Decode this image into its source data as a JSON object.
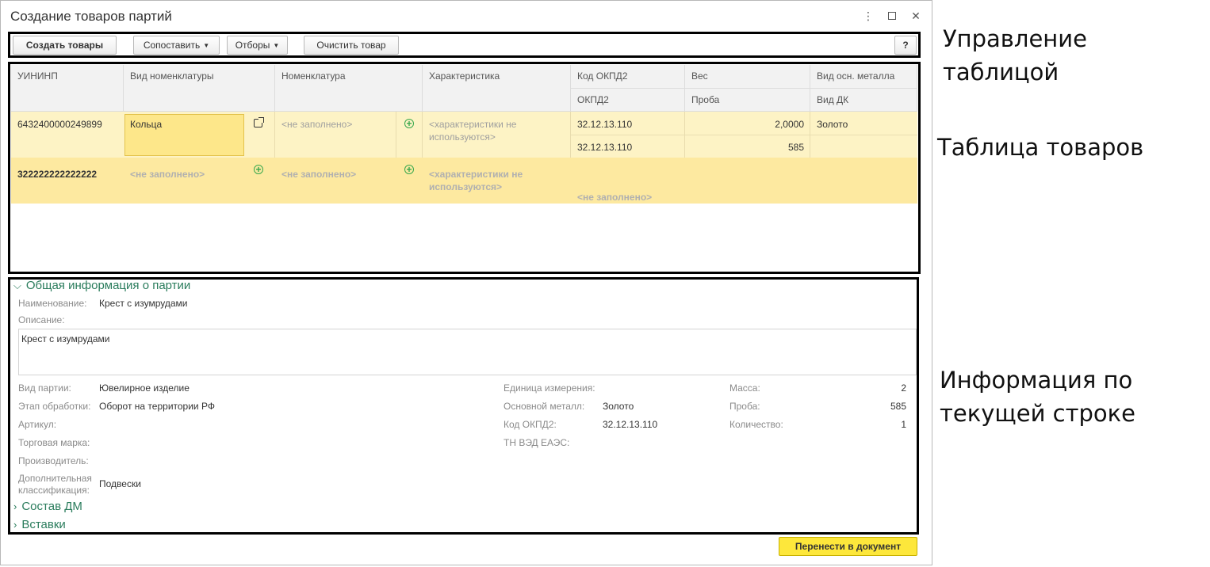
{
  "window": {
    "title": "Создание товаров партий"
  },
  "toolbar": {
    "create_label": "Создать товары",
    "match_label": "Сопоставить",
    "filters_label": "Отборы",
    "clear_label": "Очистить товар",
    "help_label": "?"
  },
  "table": {
    "headers": {
      "uininp": "УИНИНП",
      "vid_nomen": "Вид номенклатуры",
      "nomen": "Номенклатура",
      "charact": "Характеристика",
      "okpd2_code": "Код ОКПД2",
      "okpd2": "ОКПД2",
      "weight": "Вес",
      "proba": "Проба",
      "metal": "Вид осн. металла",
      "dk": "Вид ДК"
    },
    "rows": [
      {
        "uininp": "6432400000249899",
        "vid_nomen": "Кольца",
        "nomen": "<не заполнено>",
        "charact": "<характеристики не используются>",
        "okpd2_code": "32.12.13.110",
        "okpd2": "32.12.13.110",
        "weight": "2,0000",
        "proba": "585",
        "metal": "Золото"
      },
      {
        "uininp": "322222222222222",
        "vid_nomen": "<не заполнено>",
        "nomen": "<не заполнено>",
        "charact": "<характеристики не используются>",
        "okpd2": "<не заполнено>"
      }
    ]
  },
  "details": {
    "section_general": "Общая информация о партии",
    "name_label": "Наименование:",
    "name_value": "Крест с изумрудами",
    "desc_label": "Описание:",
    "desc_value": "Крест с изумрудами",
    "batch_type_label": "Вид партии:",
    "batch_type_value": "Ювелирное изделие",
    "stage_label": "Этап обработки:",
    "stage_value": "Оборот на территории РФ",
    "article_label": "Артикул:",
    "brand_label": "Торговая марка:",
    "maker_label": "Производитель:",
    "extra_label_1": "Дополнительная",
    "extra_label_2": "классификация:",
    "extra_value": "Подвески",
    "unit_label": "Единица измерения:",
    "metal_label": "Основной металл:",
    "metal_value": "Золото",
    "okpd_label": "Код ОКПД2:",
    "okpd_value": "32.12.13.110",
    "tnved_label": "ТН ВЭД ЕАЭС:",
    "mass_label": "Масса:",
    "mass_value": "2",
    "proba_label": "Проба:",
    "proba_value": "585",
    "qty_label": "Количество:",
    "qty_value": "1",
    "section_dm": "Состав ДМ",
    "section_inserts": "Вставки"
  },
  "footer": {
    "transfer_label": "Перенести в документ"
  },
  "annotations": {
    "toolbar": "Управление таблицой",
    "table": "Таблица товаров",
    "info_1": "Информация по",
    "info_2": "текущей строке"
  }
}
